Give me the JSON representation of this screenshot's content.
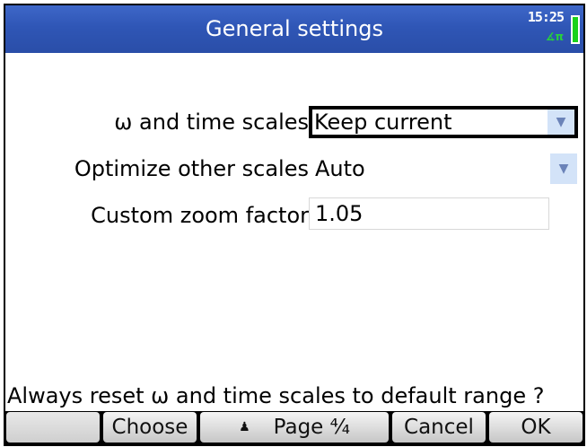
{
  "header": {
    "title": "General settings",
    "clock": "15:25",
    "angle_indicator": "∡π"
  },
  "form": {
    "omega_time_label": "ω and time scales",
    "omega_time_value": "Keep current",
    "optimize_label": "Optimize other scales",
    "optimize_value": "Auto",
    "zoom_label": "Custom zoom factor",
    "zoom_value": "1.05"
  },
  "help_text": "Always reset ω and time scales to default range ?",
  "softkeys": {
    "key1": "",
    "choose": "Choose",
    "page": "Page",
    "page_fraction": "⁴⁄₄",
    "cancel": "Cancel",
    "ok": "OK"
  },
  "colors": {
    "titlebar": "#2f56b6",
    "selection_border": "#000000",
    "dropdown_accent": "#d3e3f8",
    "battery": "#1ad21a"
  },
  "icons": {
    "dropdown": "dropdown-arrow-icon",
    "battery": "battery-icon",
    "angle": "angle-mode-icon",
    "page": "pawn-icon"
  }
}
